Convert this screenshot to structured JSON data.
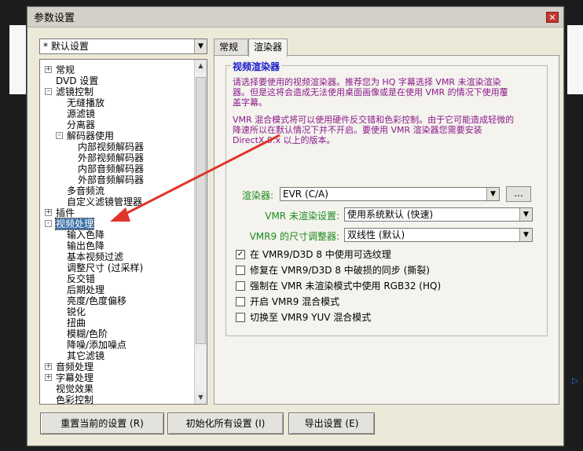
{
  "window": {
    "title": "参数设置"
  },
  "preset": {
    "value": "* 默认设置"
  },
  "tree": {
    "items": [
      {
        "label": "常规",
        "toggle": "+"
      },
      {
        "label": "DVD 设置",
        "toggle": ""
      },
      {
        "label": "滤镜控制",
        "toggle": "-"
      },
      {
        "label": "无缝播放",
        "toggle": ""
      },
      {
        "label": "源滤镜",
        "toggle": ""
      },
      {
        "label": "分离器",
        "toggle": ""
      },
      {
        "label": "解码器使用",
        "toggle": "-"
      },
      {
        "label": "内部视频解码器",
        "toggle": ""
      },
      {
        "label": "外部视频解码器",
        "toggle": ""
      },
      {
        "label": "内部音频解码器",
        "toggle": ""
      },
      {
        "label": "外部音频解码器",
        "toggle": ""
      },
      {
        "label": "多音频流",
        "toggle": ""
      },
      {
        "label": "自定义滤镜管理器",
        "toggle": ""
      },
      {
        "label": "插件",
        "toggle": "+"
      },
      {
        "label": "视频处理",
        "toggle": "-"
      },
      {
        "label": "输入色降",
        "toggle": ""
      },
      {
        "label": "输出色降",
        "toggle": ""
      },
      {
        "label": "基本视频过滤",
        "toggle": ""
      },
      {
        "label": "调整尺寸 (过采样)",
        "toggle": ""
      },
      {
        "label": "反交错",
        "toggle": ""
      },
      {
        "label": "后期处理",
        "toggle": ""
      },
      {
        "label": "亮度/色度偏移",
        "toggle": ""
      },
      {
        "label": "锐化",
        "toggle": ""
      },
      {
        "label": "扭曲",
        "toggle": ""
      },
      {
        "label": "模糊/色阶",
        "toggle": ""
      },
      {
        "label": "降噪/添加噪点",
        "toggle": ""
      },
      {
        "label": "其它滤镜",
        "toggle": ""
      },
      {
        "label": "音频处理",
        "toggle": "+"
      },
      {
        "label": "字幕处理",
        "toggle": "+"
      },
      {
        "label": "视觉效果",
        "toggle": ""
      },
      {
        "label": "色彩控制",
        "toggle": ""
      }
    ]
  },
  "tabs": [
    {
      "label": "常规"
    },
    {
      "label": "渲染器"
    }
  ],
  "renderer": {
    "group_title": "视频渲染器",
    "desc1": "请选择要使用的视频渲染器。推荐您为 HQ 字幕选择 VMR 未渲染渲染器。但是这将会造成无法使用桌面画像或是在使用 VMR 的情况下使用覆盖字幕。",
    "desc2": "VMR 混合模式将可以使用硬件反交错和色彩控制。由于它可能造成轻微的降速所以在默认情况下并不开启。要使用 VMR 渲染器您需要安装 DirectX 9.x 以上的版本。",
    "renderer_label": "渲染器:",
    "renderer_value": "EVR (C/A)",
    "dots": "...",
    "unrendered_label": "VMR 未渲染设置:",
    "unrendered_value": "使用系统默认 (快速)",
    "resizer_label": "VMR9 的尺寸调整器:",
    "resizer_value": "双线性 (默认)",
    "checks": [
      {
        "label": "在 VMR9/D3D 8 中使用可选纹理",
        "checked": "✓"
      },
      {
        "label": "修复在 VMR9/D3D 8 中破损的同步 (撕裂)",
        "checked": ""
      },
      {
        "label": "强制在 VMR 未渲染模式中使用 RGB32 (HQ)",
        "checked": ""
      },
      {
        "label": "开启 VMR9 混合模式",
        "checked": ""
      },
      {
        "label": "切换至 VMR9 YUV 混合模式",
        "checked": ""
      }
    ]
  },
  "buttons": {
    "reset": "重置当前的设置 (R)",
    "init": "初始化所有设置 (I)",
    "export": "导出设置 (E)"
  },
  "colors": {
    "arrow": "#e0342b",
    "selection": "#3a6ea5"
  }
}
